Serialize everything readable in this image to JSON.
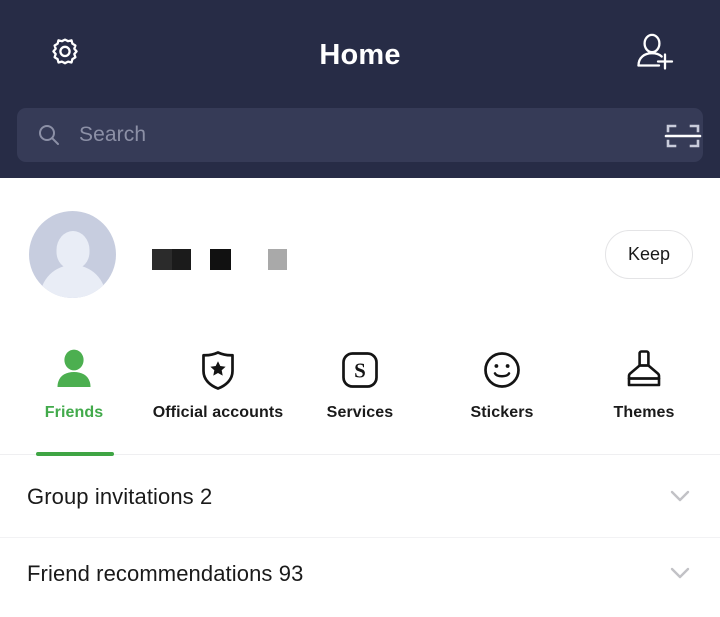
{
  "header": {
    "title": "Home",
    "background_color": "#272c46",
    "settings_icon": "gear-icon",
    "add_friend_icon": "add-friend-icon",
    "search": {
      "placeholder": "Search",
      "value": "",
      "icon": "search-icon",
      "scan_icon": "qr-scan-icon"
    }
  },
  "profile": {
    "avatar_icon": "default-avatar-icon",
    "display_name_redacted": true,
    "keep_button_label": "Keep"
  },
  "tabs": {
    "accent_color": "#3fa544",
    "items": [
      {
        "label": "Friends",
        "icon": "person-filled-icon",
        "active": true
      },
      {
        "label": "Official accounts",
        "icon": "shield-star-icon",
        "active": false
      },
      {
        "label": "Services",
        "icon": "service-s-icon",
        "active": false
      },
      {
        "label": "Stickers",
        "icon": "smiley-face-icon",
        "active": false
      },
      {
        "label": "Themes",
        "icon": "paintbrush-icon",
        "active": false
      }
    ]
  },
  "list": {
    "rows": [
      {
        "label": "Group invitations 2",
        "chevron": "chevron-down-icon"
      },
      {
        "label": "Friend recommendations 93",
        "chevron": "chevron-down-icon"
      }
    ]
  }
}
